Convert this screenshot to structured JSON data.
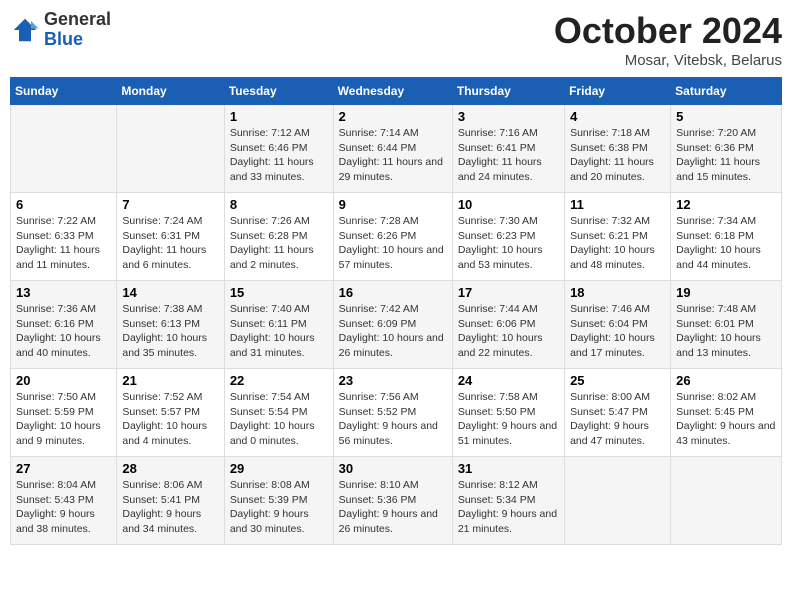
{
  "logo": {
    "general": "General",
    "blue": "Blue"
  },
  "title": "October 2024",
  "location": "Mosar, Vitebsk, Belarus",
  "headers": [
    "Sunday",
    "Monday",
    "Tuesday",
    "Wednesday",
    "Thursday",
    "Friday",
    "Saturday"
  ],
  "weeks": [
    [
      {
        "day": "",
        "sunrise": "",
        "sunset": "",
        "daylight": ""
      },
      {
        "day": "",
        "sunrise": "",
        "sunset": "",
        "daylight": ""
      },
      {
        "day": "1",
        "sunrise": "Sunrise: 7:12 AM",
        "sunset": "Sunset: 6:46 PM",
        "daylight": "Daylight: 11 hours and 33 minutes."
      },
      {
        "day": "2",
        "sunrise": "Sunrise: 7:14 AM",
        "sunset": "Sunset: 6:44 PM",
        "daylight": "Daylight: 11 hours and 29 minutes."
      },
      {
        "day": "3",
        "sunrise": "Sunrise: 7:16 AM",
        "sunset": "Sunset: 6:41 PM",
        "daylight": "Daylight: 11 hours and 24 minutes."
      },
      {
        "day": "4",
        "sunrise": "Sunrise: 7:18 AM",
        "sunset": "Sunset: 6:38 PM",
        "daylight": "Daylight: 11 hours and 20 minutes."
      },
      {
        "day": "5",
        "sunrise": "Sunrise: 7:20 AM",
        "sunset": "Sunset: 6:36 PM",
        "daylight": "Daylight: 11 hours and 15 minutes."
      }
    ],
    [
      {
        "day": "6",
        "sunrise": "Sunrise: 7:22 AM",
        "sunset": "Sunset: 6:33 PM",
        "daylight": "Daylight: 11 hours and 11 minutes."
      },
      {
        "day": "7",
        "sunrise": "Sunrise: 7:24 AM",
        "sunset": "Sunset: 6:31 PM",
        "daylight": "Daylight: 11 hours and 6 minutes."
      },
      {
        "day": "8",
        "sunrise": "Sunrise: 7:26 AM",
        "sunset": "Sunset: 6:28 PM",
        "daylight": "Daylight: 11 hours and 2 minutes."
      },
      {
        "day": "9",
        "sunrise": "Sunrise: 7:28 AM",
        "sunset": "Sunset: 6:26 PM",
        "daylight": "Daylight: 10 hours and 57 minutes."
      },
      {
        "day": "10",
        "sunrise": "Sunrise: 7:30 AM",
        "sunset": "Sunset: 6:23 PM",
        "daylight": "Daylight: 10 hours and 53 minutes."
      },
      {
        "day": "11",
        "sunrise": "Sunrise: 7:32 AM",
        "sunset": "Sunset: 6:21 PM",
        "daylight": "Daylight: 10 hours and 48 minutes."
      },
      {
        "day": "12",
        "sunrise": "Sunrise: 7:34 AM",
        "sunset": "Sunset: 6:18 PM",
        "daylight": "Daylight: 10 hours and 44 minutes."
      }
    ],
    [
      {
        "day": "13",
        "sunrise": "Sunrise: 7:36 AM",
        "sunset": "Sunset: 6:16 PM",
        "daylight": "Daylight: 10 hours and 40 minutes."
      },
      {
        "day": "14",
        "sunrise": "Sunrise: 7:38 AM",
        "sunset": "Sunset: 6:13 PM",
        "daylight": "Daylight: 10 hours and 35 minutes."
      },
      {
        "day": "15",
        "sunrise": "Sunrise: 7:40 AM",
        "sunset": "Sunset: 6:11 PM",
        "daylight": "Daylight: 10 hours and 31 minutes."
      },
      {
        "day": "16",
        "sunrise": "Sunrise: 7:42 AM",
        "sunset": "Sunset: 6:09 PM",
        "daylight": "Daylight: 10 hours and 26 minutes."
      },
      {
        "day": "17",
        "sunrise": "Sunrise: 7:44 AM",
        "sunset": "Sunset: 6:06 PM",
        "daylight": "Daylight: 10 hours and 22 minutes."
      },
      {
        "day": "18",
        "sunrise": "Sunrise: 7:46 AM",
        "sunset": "Sunset: 6:04 PM",
        "daylight": "Daylight: 10 hours and 17 minutes."
      },
      {
        "day": "19",
        "sunrise": "Sunrise: 7:48 AM",
        "sunset": "Sunset: 6:01 PM",
        "daylight": "Daylight: 10 hours and 13 minutes."
      }
    ],
    [
      {
        "day": "20",
        "sunrise": "Sunrise: 7:50 AM",
        "sunset": "Sunset: 5:59 PM",
        "daylight": "Daylight: 10 hours and 9 minutes."
      },
      {
        "day": "21",
        "sunrise": "Sunrise: 7:52 AM",
        "sunset": "Sunset: 5:57 PM",
        "daylight": "Daylight: 10 hours and 4 minutes."
      },
      {
        "day": "22",
        "sunrise": "Sunrise: 7:54 AM",
        "sunset": "Sunset: 5:54 PM",
        "daylight": "Daylight: 10 hours and 0 minutes."
      },
      {
        "day": "23",
        "sunrise": "Sunrise: 7:56 AM",
        "sunset": "Sunset: 5:52 PM",
        "daylight": "Daylight: 9 hours and 56 minutes."
      },
      {
        "day": "24",
        "sunrise": "Sunrise: 7:58 AM",
        "sunset": "Sunset: 5:50 PM",
        "daylight": "Daylight: 9 hours and 51 minutes."
      },
      {
        "day": "25",
        "sunrise": "Sunrise: 8:00 AM",
        "sunset": "Sunset: 5:47 PM",
        "daylight": "Daylight: 9 hours and 47 minutes."
      },
      {
        "day": "26",
        "sunrise": "Sunrise: 8:02 AM",
        "sunset": "Sunset: 5:45 PM",
        "daylight": "Daylight: 9 hours and 43 minutes."
      }
    ],
    [
      {
        "day": "27",
        "sunrise": "Sunrise: 8:04 AM",
        "sunset": "Sunset: 5:43 PM",
        "daylight": "Daylight: 9 hours and 38 minutes."
      },
      {
        "day": "28",
        "sunrise": "Sunrise: 8:06 AM",
        "sunset": "Sunset: 5:41 PM",
        "daylight": "Daylight: 9 hours and 34 minutes."
      },
      {
        "day": "29",
        "sunrise": "Sunrise: 8:08 AM",
        "sunset": "Sunset: 5:39 PM",
        "daylight": "Daylight: 9 hours and 30 minutes."
      },
      {
        "day": "30",
        "sunrise": "Sunrise: 8:10 AM",
        "sunset": "Sunset: 5:36 PM",
        "daylight": "Daylight: 9 hours and 26 minutes."
      },
      {
        "day": "31",
        "sunrise": "Sunrise: 8:12 AM",
        "sunset": "Sunset: 5:34 PM",
        "daylight": "Daylight: 9 hours and 21 minutes."
      },
      {
        "day": "",
        "sunrise": "",
        "sunset": "",
        "daylight": ""
      },
      {
        "day": "",
        "sunrise": "",
        "sunset": "",
        "daylight": ""
      }
    ]
  ]
}
